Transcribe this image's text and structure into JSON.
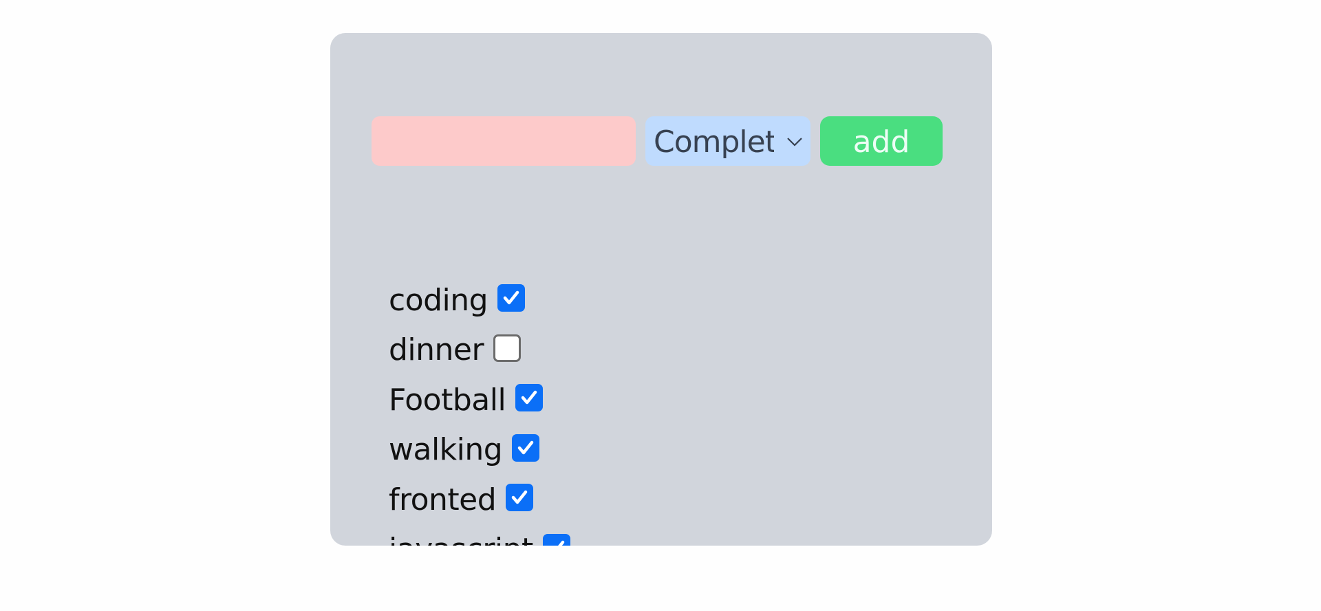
{
  "form": {
    "task_input_value": "",
    "task_input_placeholder": "",
    "status_select_value": "Completed",
    "add_label": "add"
  },
  "todos": [
    {
      "label": "coding",
      "checked": true
    },
    {
      "label": "dinner",
      "checked": false
    },
    {
      "label": "Football",
      "checked": true
    },
    {
      "label": "walking",
      "checked": true
    },
    {
      "label": "fronted",
      "checked": true
    },
    {
      "label": "javascript",
      "checked": true
    }
  ],
  "colors": {
    "card_background": "#d1d5dc",
    "input_background": "#fdcaca",
    "select_background": "#bfdbfe",
    "add_button_background": "#4ade80",
    "checkbox_checked": "#0b6ff7"
  }
}
